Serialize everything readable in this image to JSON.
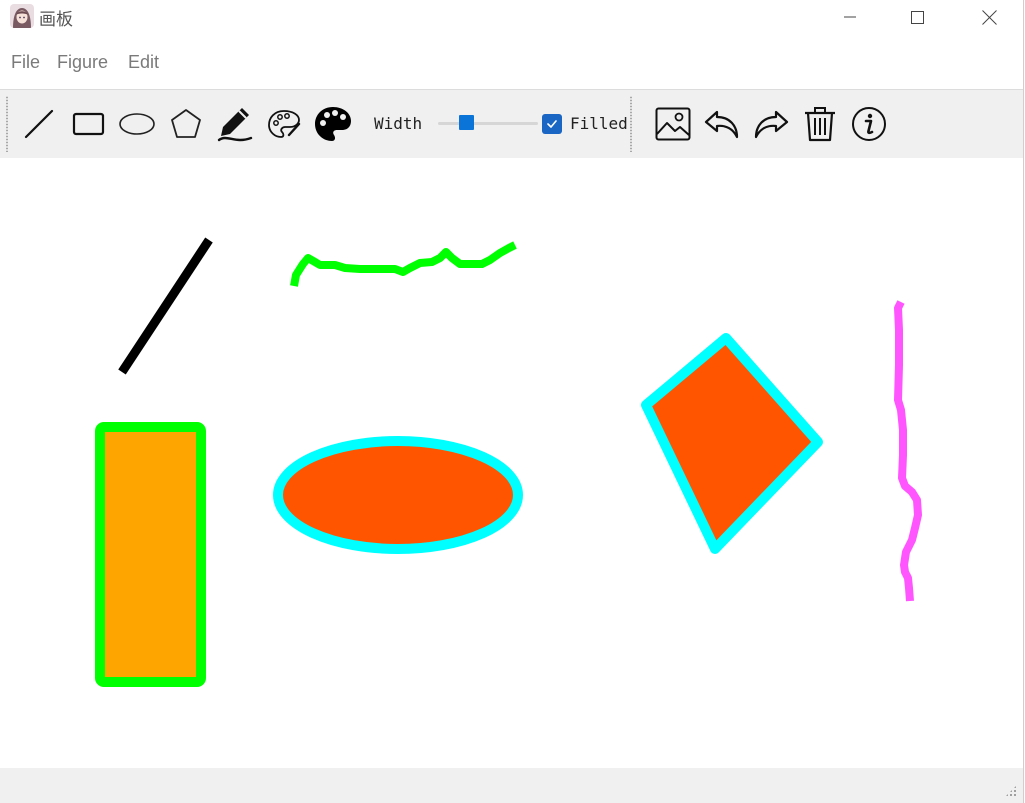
{
  "window": {
    "title": "画板",
    "controls": [
      "minimize-icon",
      "maximize-icon",
      "close-icon"
    ]
  },
  "menu": {
    "items": [
      {
        "label": "File"
      },
      {
        "label": "Figure"
      },
      {
        "label": "Edit"
      }
    ]
  },
  "toolbar": {
    "tools": [
      {
        "icon": "line-icon"
      },
      {
        "icon": "rectangle-icon"
      },
      {
        "icon": "ellipse-icon"
      },
      {
        "icon": "polygon-icon"
      },
      {
        "icon": "pen-icon"
      },
      {
        "icon": "palette-outline-icon"
      },
      {
        "icon": "palette-filled-icon"
      }
    ],
    "width_label": "Width",
    "width_value": 0.25,
    "filled_label": "Filled",
    "filled_checked": true,
    "actions": [
      {
        "icon": "image-icon"
      },
      {
        "icon": "undo-icon"
      },
      {
        "icon": "redo-icon"
      },
      {
        "icon": "trash-icon"
      },
      {
        "icon": "info-icon"
      }
    ]
  },
  "canvas": {
    "shapes": [
      {
        "kind": "line",
        "stroke": "#000000"
      },
      {
        "kind": "freehand",
        "stroke": "#00ff00"
      },
      {
        "kind": "rectangle",
        "stroke": "#00ff00",
        "fill": "#ffa500"
      },
      {
        "kind": "ellipse",
        "stroke": "#00ffff",
        "fill": "#ff5500"
      },
      {
        "kind": "polygon",
        "stroke": "#00ffff",
        "fill": "#ff5500"
      },
      {
        "kind": "freehand",
        "stroke": "#ff55ff"
      }
    ]
  },
  "colors": {
    "accent": "#0a74d8",
    "toolbar_bg": "#f0f0f0"
  }
}
